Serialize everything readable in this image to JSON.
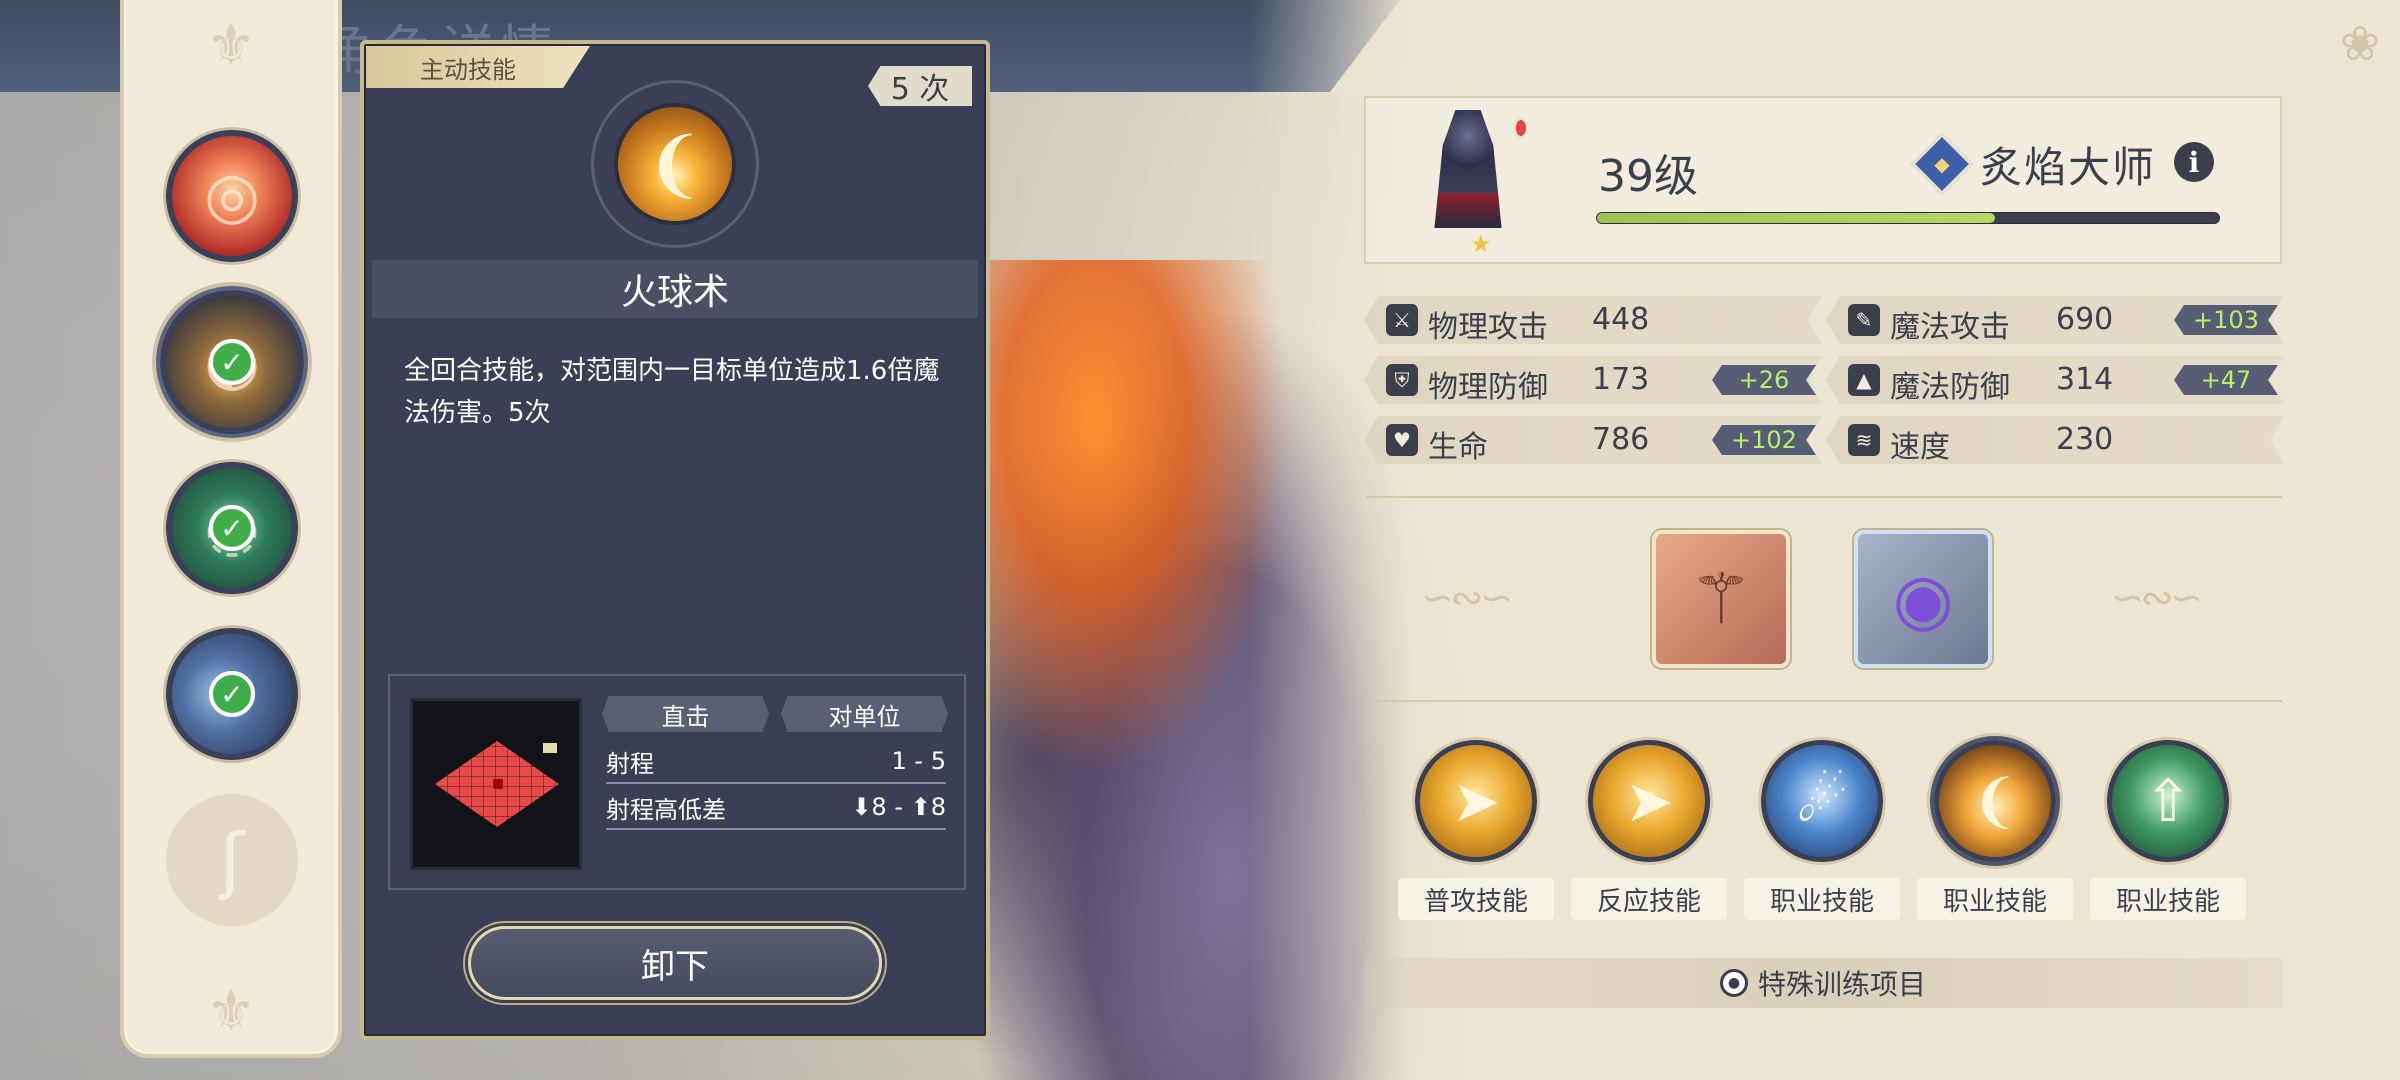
{
  "header": {
    "title": "角色详情"
  },
  "skill_slots": [
    {
      "name": "fire-vortex-skill",
      "equipped": false
    },
    {
      "name": "fireball-skill",
      "equipped": true
    },
    {
      "name": "green-wind-skill",
      "equipped": true
    },
    {
      "name": "dash-skill",
      "equipped": true
    },
    {
      "name": "empty-staff-slot",
      "equipped": false
    }
  ],
  "detail": {
    "tag": "主动技能",
    "uses": "5 次",
    "skill_name": "火球术",
    "description": "全回合技能，对范围内一目标单位造成1.6倍魔法伤害。5次",
    "attack_type": "直击",
    "target_type": "对单位",
    "range_label": "射程",
    "range_value": "1 - 5",
    "height_label": "射程高低差",
    "height_value": "⬇8 - ⬆8",
    "unequip_label": "卸下"
  },
  "character": {
    "level": "39级",
    "class_name": "炙焰大师",
    "exp_progress": 0.64,
    "rarity_stars": 1
  },
  "stats": [
    {
      "label": "物理攻击",
      "value": "448",
      "bonus": "",
      "icon": "sword-icon"
    },
    {
      "label": "魔法攻击",
      "value": "690",
      "bonus": "+103",
      "icon": "wand-icon"
    },
    {
      "label": "物理防御",
      "value": "173",
      "bonus": "+26",
      "icon": "shield-icon"
    },
    {
      "label": "魔法防御",
      "value": "314",
      "bonus": "+47",
      "icon": "wizard-hat-icon"
    },
    {
      "label": "生命",
      "value": "786",
      "bonus": "+102",
      "icon": "heart-icon"
    },
    {
      "label": "速度",
      "value": "230",
      "bonus": "",
      "icon": "wing-icon"
    }
  ],
  "equipment": [
    {
      "name": "staff-weapon",
      "icon": "staff-icon"
    },
    {
      "name": "orb-accessory",
      "icon": "orb-icon"
    }
  ],
  "skill_buttons": [
    {
      "label": "普攻技能",
      "icon": "double-arrow-icon",
      "style": "gold"
    },
    {
      "label": "反应技能",
      "icon": "double-arrow-icon",
      "style": "gold"
    },
    {
      "label": "职业技能",
      "icon": "running-icon",
      "style": "blue"
    },
    {
      "label": "职业技能",
      "icon": "fireball-icon",
      "style": "fire"
    },
    {
      "label": "职业技能",
      "icon": "up-arrow-icon",
      "style": "green"
    }
  ],
  "training": {
    "label": "特殊训练项目"
  },
  "colors": {
    "panel": "#3a3f55",
    "parchment": "#ece5d3",
    "bonus_text": "#b7f06a",
    "exp_fill": "#9bc452",
    "check": "#3fae4a"
  }
}
